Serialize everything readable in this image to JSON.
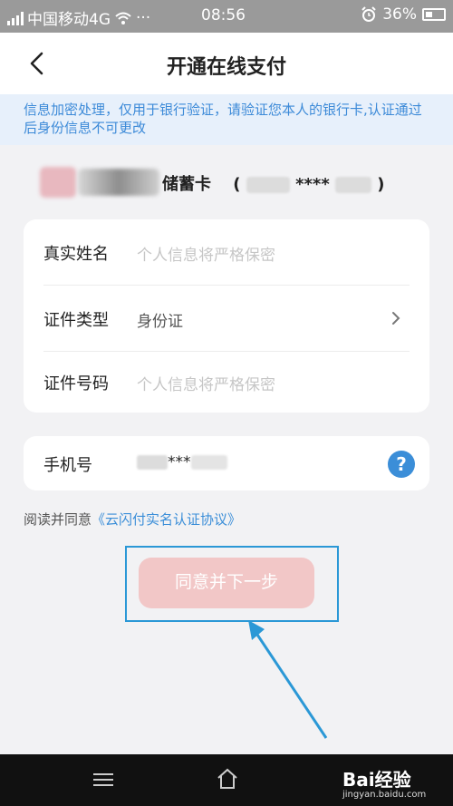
{
  "status_bar": {
    "carrier": "中国移动4G",
    "time": "08:56",
    "battery": "36%"
  },
  "header": {
    "title": "开通在线支付"
  },
  "notice": {
    "text": "信息加密处理，仅用于银行验证，请验证您本人的银行卡,认证通过后身份信息不可更改"
  },
  "card": {
    "label": "储蓄卡",
    "number_masked": "****"
  },
  "form": {
    "rows": [
      {
        "label": "真实姓名",
        "placeholder": "个人信息将严格保密"
      },
      {
        "label": "证件类型",
        "value": "身份证"
      },
      {
        "label": "证件号码",
        "placeholder": "个人信息将严格保密"
      }
    ],
    "phone": {
      "label": "手机号",
      "masked": "***"
    }
  },
  "agreement": {
    "prefix": "阅读并同意",
    "link": "《云闪付实名认证协议》"
  },
  "next_button": {
    "label": "同意并下一步"
  },
  "watermark": {
    "text": "Bai经验",
    "sub": "jingyan.baidu.com"
  },
  "colors": {
    "accent": "#3b8ed8",
    "button_bg": "#f2c7c7",
    "notice_bg": "#e7f0fb",
    "highlight": "#2b98d6"
  }
}
